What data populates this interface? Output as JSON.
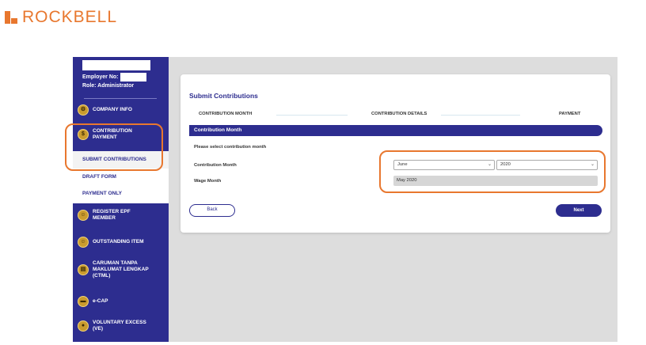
{
  "brand": {
    "name": "ROCKBELL",
    "color": "#e8772e"
  },
  "sidebar": {
    "employer_label": "Employer No:",
    "role_label": "Role: Administrator",
    "items": [
      {
        "label": "COMPANY INFO",
        "icon": "gear-icon"
      },
      {
        "label": "CONTRIBUTION PAYMENT",
        "icon": "money-bag-icon"
      },
      {
        "label": "REGISTER EPF MEMBER",
        "icon": "person-icon"
      },
      {
        "label": "OUTSTANDING ITEM",
        "icon": "person-icon"
      },
      {
        "label": "CARUMAN TANPA MAKLUMAT LENGKAP (CTML)",
        "icon": "document-icon"
      },
      {
        "label": "e-CAP",
        "icon": "card-icon"
      },
      {
        "label": "VOLUNTARY EXCESS (VE)",
        "icon": "coin-icon"
      }
    ],
    "submenu": [
      {
        "label": "SUBMIT CONTRIBUTIONS"
      },
      {
        "label": "DRAFT FORM"
      },
      {
        "label": "PAYMENT ONLY"
      }
    ]
  },
  "card": {
    "title": "Submit Contributions",
    "steps": [
      "CONTRIBUTION MONTH",
      "CONTRIBUTION DETAILS",
      "PAYMENT"
    ],
    "section_title": "Contribution Month",
    "hint": "Please select contribution month",
    "contribution_month_label": "Contribution Month",
    "wage_month_label": "Wage Month",
    "month_select": "June",
    "year_select": "2020",
    "wage_month_value": "May 2020",
    "back_label": "Back",
    "next_label": "Next"
  },
  "colors": {
    "primary": "#2d2d8f",
    "highlight": "#e8772e",
    "icon_gold": "#c99b2e"
  }
}
